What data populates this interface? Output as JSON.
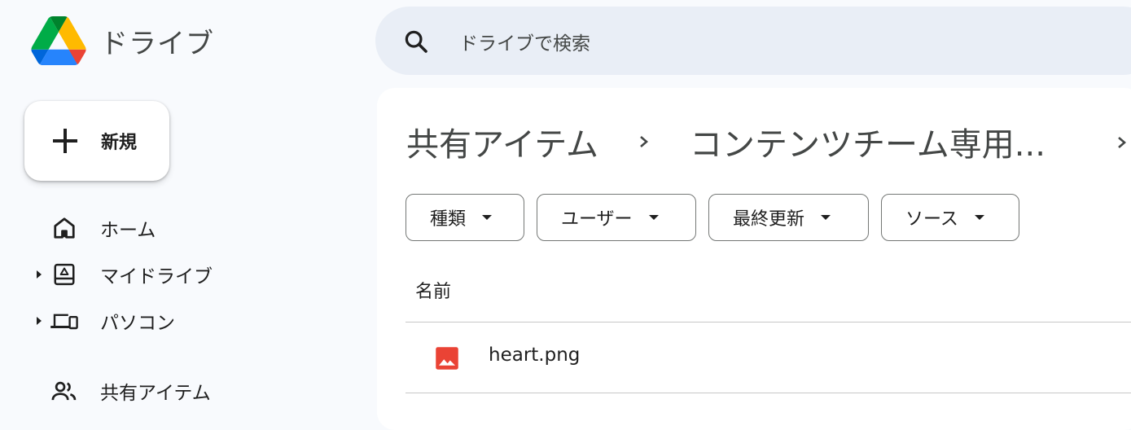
{
  "app": {
    "name": "ドライブ"
  },
  "sidebar": {
    "new_button_label": "新規",
    "items": [
      {
        "label": "ホーム",
        "icon": "home-icon"
      },
      {
        "label": "マイドライブ",
        "icon": "my-drive-icon"
      },
      {
        "label": "パソコン",
        "icon": "computers-icon"
      },
      {
        "label": "共有アイテム",
        "icon": "shared-icon"
      }
    ]
  },
  "search": {
    "placeholder": "ドライブで検索"
  },
  "breadcrumb": {
    "items": [
      "共有アイテム",
      "コンテンツチーム専用..."
    ]
  },
  "filters": [
    {
      "label": "種類"
    },
    {
      "label": "ユーザー"
    },
    {
      "label": "最終更新"
    },
    {
      "label": "ソース"
    }
  ],
  "table": {
    "columns": [
      "名前"
    ],
    "rows": [
      {
        "name": "heart.png",
        "type_icon": "image-file-icon"
      }
    ]
  },
  "colors": {
    "background": "#f8fafd",
    "search_bg": "#e9eef6",
    "panel_bg": "#ffffff",
    "image_file_icon": "#ea4335"
  }
}
